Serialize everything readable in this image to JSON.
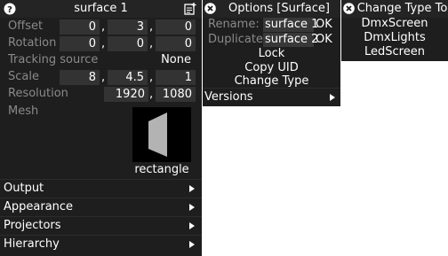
{
  "surface_panel": {
    "title": "surface 1",
    "offset": {
      "label": "Offset",
      "x": "0",
      "y": "3",
      "z": "0"
    },
    "rotation": {
      "label": "Rotation",
      "x": "0",
      "y": "0",
      "z": "0"
    },
    "tracking": {
      "label": "Tracking source",
      "value": "None"
    },
    "scale": {
      "label": "Scale",
      "x": "8",
      "y": "4.5",
      "z": "1"
    },
    "resolution": {
      "label": "Resolution",
      "w": "1920",
      "h": "1080"
    },
    "mesh": {
      "label": "Mesh",
      "name": "rectangle"
    },
    "separator": ",",
    "sections": [
      "Output",
      "Appearance",
      "Projectors",
      "Hierarchy"
    ]
  },
  "options_panel": {
    "title": "Options [Surface]",
    "rename": {
      "label": "Rename:",
      "value": "surface 1",
      "ok": "OK"
    },
    "duplicate": {
      "label": "Duplicate:",
      "value": "surface 2",
      "ok": "OK"
    },
    "actions": [
      "Lock",
      "Copy UID",
      "Change Type"
    ],
    "versions": "Versions"
  },
  "change_type_panel": {
    "title": "Change Type To",
    "items": [
      "DmxScreen",
      "DmxLights",
      "LedScreen"
    ]
  },
  "icons": [
    "help-icon",
    "add-note-icon",
    "close-icon",
    "submenu-arrow-icon"
  ]
}
